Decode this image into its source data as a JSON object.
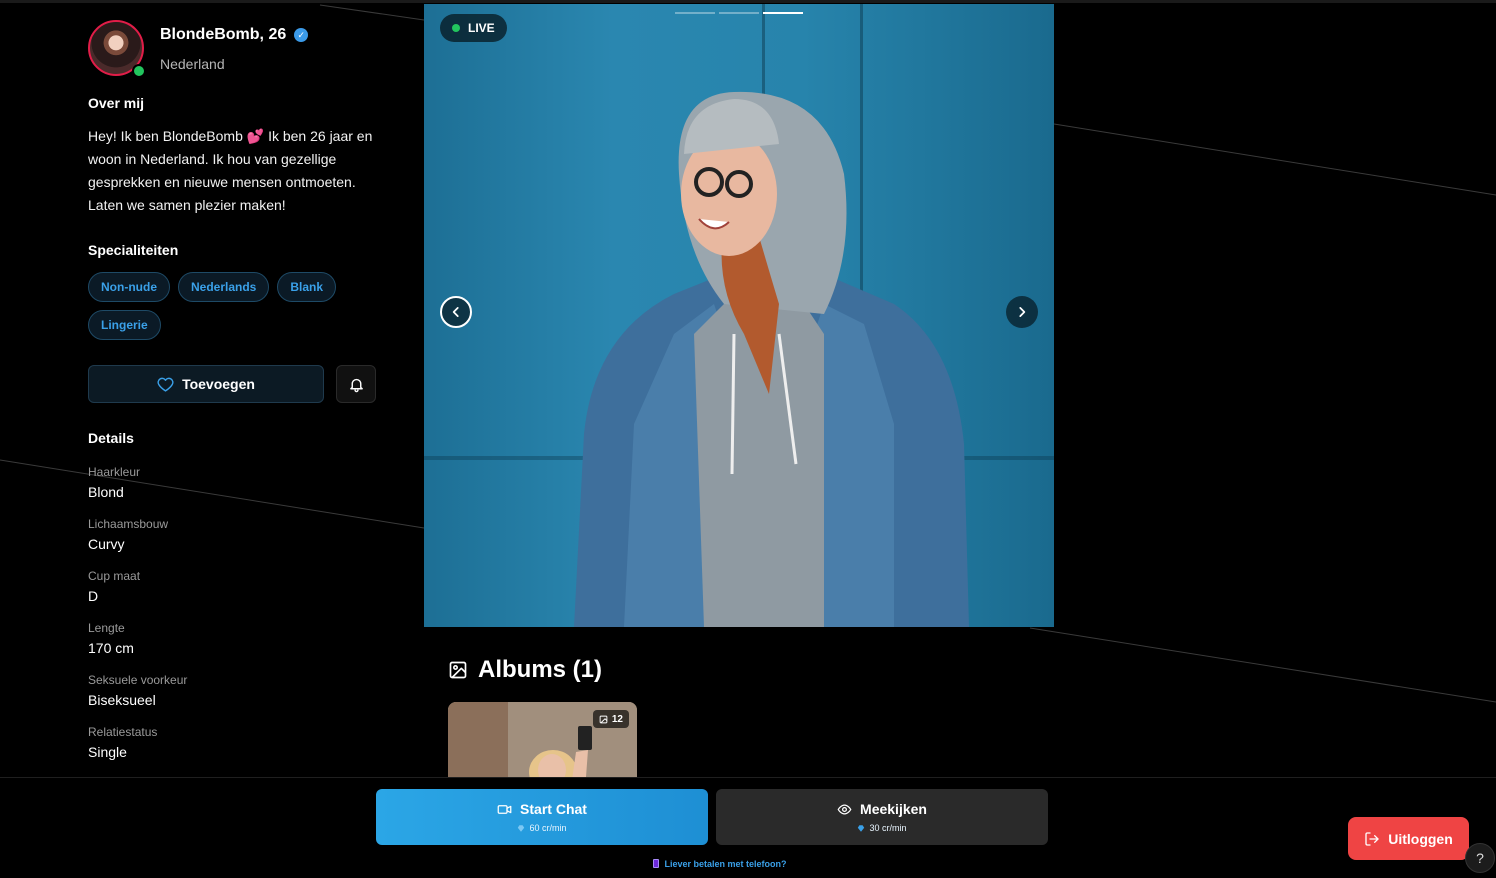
{
  "profile": {
    "name": "BlondeBomb, 26",
    "country": "Nederland",
    "online": true,
    "verified": true
  },
  "about": {
    "title": "Over mij",
    "text": "Hey! Ik ben BlondeBomb 💕 Ik ben 26 jaar en woon in Nederland. Ik hou van gezellige gesprekken en nieuwe mensen ontmoeten. Laten we samen plezier maken!"
  },
  "specialties": {
    "title": "Specialiteiten",
    "tags": [
      "Non-nude",
      "Nederlands",
      "Blank",
      "Lingerie"
    ]
  },
  "actions": {
    "favorite_label": "Toevoegen",
    "favorite_icon": "heart-icon",
    "notify_icon": "bell-icon"
  },
  "details": {
    "title": "Details",
    "items": [
      {
        "label": "Haarkleur",
        "value": "Blond"
      },
      {
        "label": "Lichaamsbouw",
        "value": "Curvy"
      },
      {
        "label": "Cup maat",
        "value": "D"
      },
      {
        "label": "Lengte",
        "value": "170 cm"
      },
      {
        "label": "Seksuele voorkeur",
        "value": "Biseksueel"
      },
      {
        "label": "Relatiestatus",
        "value": "Single"
      }
    ]
  },
  "carousel": {
    "live_label": "LIVE",
    "slide_count": 3,
    "active_slide": 3
  },
  "albums": {
    "title": "Albums (1)",
    "items": [
      {
        "count": "12"
      }
    ]
  },
  "bottom": {
    "chat_label": "Start Chat",
    "chat_price": "60 cr/min",
    "watch_label": "Meekijken",
    "watch_price": "30 cr/min",
    "phone_link": "Liever betalen met telefoon?"
  },
  "logout_label": "Uitloggen",
  "help_label": "?",
  "colors": {
    "accent": "#2ba6e6",
    "online": "#22c55e",
    "logout": "#ef4444",
    "chip_text": "#3aa0e8"
  }
}
